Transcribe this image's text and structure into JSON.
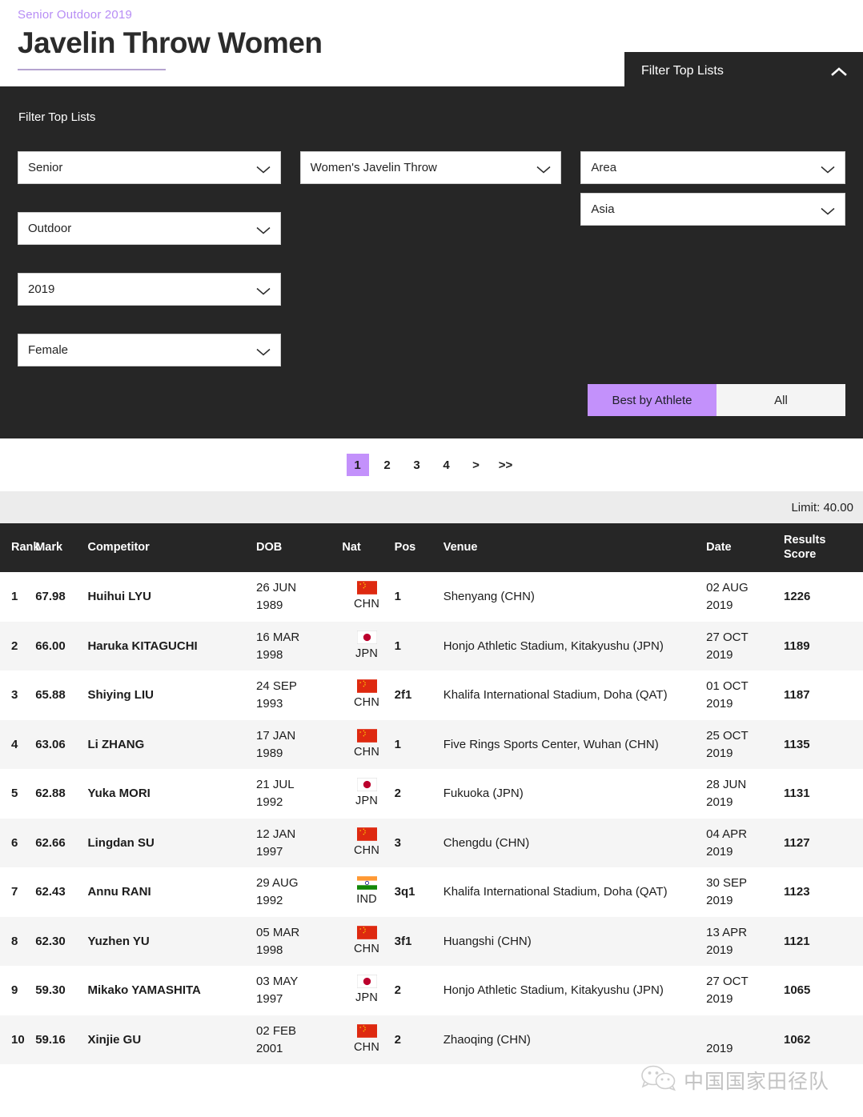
{
  "header": {
    "eyebrow": "Senior Outdoor 2019",
    "title": "Javelin Throw Women"
  },
  "filter_float": {
    "label": "Filter Top Lists",
    "chevron_icon": "chevron-up-icon"
  },
  "filter_panel": {
    "title": "Filter Top Lists",
    "selects": [
      {
        "name": "age-category",
        "value": "Senior"
      },
      {
        "name": "discipline",
        "value": "Women's Javelin Throw"
      },
      {
        "name": "area",
        "value": "Area"
      },
      {
        "name": "environment",
        "value": "Outdoor"
      },
      {
        "name": "region",
        "value": "Asia"
      },
      {
        "name": "season-year",
        "value": "2019"
      },
      {
        "name": "gender",
        "value": "Female"
      }
    ],
    "toggle": {
      "best_by_athlete": "Best by Athlete",
      "all": "All",
      "active": "Best by Athlete"
    }
  },
  "pagination": {
    "pages": [
      "1",
      "2",
      "3",
      "4"
    ],
    "next": ">",
    "last": ">>",
    "current": "1"
  },
  "limit_bar": {
    "text": "Limit: 40.00"
  },
  "table": {
    "columns": [
      "Rank",
      "Mark",
      "Competitor",
      "DOB",
      "Nat",
      "Pos",
      "Venue",
      "Date",
      "Results Score"
    ],
    "rows": [
      {
        "rank": "1",
        "mark": "67.98",
        "competitor": "Huihui LYU",
        "dob_day": "26 JUN",
        "dob_year": "1989",
        "nat": "CHN",
        "flag": "flag-china",
        "pos": "1",
        "venue": "Shenyang (CHN)",
        "date_day": "02 AUG",
        "date_year": "2019",
        "score": "1226"
      },
      {
        "rank": "2",
        "mark": "66.00",
        "competitor": "Haruka KITAGUCHI",
        "dob_day": "16 MAR",
        "dob_year": "1998",
        "nat": "JPN",
        "flag": "flag-japan",
        "pos": "1",
        "venue": "Honjo Athletic Stadium, Kitakyushu (JPN)",
        "date_day": "27 OCT",
        "date_year": "2019",
        "score": "1189"
      },
      {
        "rank": "3",
        "mark": "65.88",
        "competitor": "Shiying LIU",
        "dob_day": "24 SEP",
        "dob_year": "1993",
        "nat": "CHN",
        "flag": "flag-china",
        "pos": "2f1",
        "venue": "Khalifa International Stadium, Doha (QAT)",
        "date_day": "01 OCT",
        "date_year": "2019",
        "score": "1187"
      },
      {
        "rank": "4",
        "mark": "63.06",
        "competitor": "Li ZHANG",
        "dob_day": "17 JAN",
        "dob_year": "1989",
        "nat": "CHN",
        "flag": "flag-china",
        "pos": "1",
        "venue": "Five Rings Sports Center, Wuhan (CHN)",
        "date_day": "25 OCT",
        "date_year": "2019",
        "score": "1135"
      },
      {
        "rank": "5",
        "mark": "62.88",
        "competitor": "Yuka MORI",
        "dob_day": "21 JUL",
        "dob_year": "1992",
        "nat": "JPN",
        "flag": "flag-japan",
        "pos": "2",
        "venue": "Fukuoka (JPN)",
        "date_day": "28 JUN",
        "date_year": "2019",
        "score": "1131"
      },
      {
        "rank": "6",
        "mark": "62.66",
        "competitor": "Lingdan SU",
        "dob_day": "12 JAN",
        "dob_year": "1997",
        "nat": "CHN",
        "flag": "flag-china",
        "pos": "3",
        "venue": "Chengdu (CHN)",
        "date_day": "04 APR",
        "date_year": "2019",
        "score": "1127"
      },
      {
        "rank": "7",
        "mark": "62.43",
        "competitor": "Annu RANI",
        "dob_day": "29 AUG",
        "dob_year": "1992",
        "nat": "IND",
        "flag": "flag-india",
        "pos": "3q1",
        "venue": "Khalifa International Stadium, Doha (QAT)",
        "date_day": "30 SEP",
        "date_year": "2019",
        "score": "1123"
      },
      {
        "rank": "8",
        "mark": "62.30",
        "competitor": "Yuzhen YU",
        "dob_day": "05 MAR",
        "dob_year": "1998",
        "nat": "CHN",
        "flag": "flag-china",
        "pos": "3f1",
        "venue": "Huangshi (CHN)",
        "date_day": "13 APR",
        "date_year": "2019",
        "score": "1121"
      },
      {
        "rank": "9",
        "mark": "59.30",
        "competitor": "Mikako YAMASHITA",
        "dob_day": "03 MAY",
        "dob_year": "1997",
        "nat": "JPN",
        "flag": "flag-japan",
        "pos": "2",
        "venue": "Honjo Athletic Stadium, Kitakyushu (JPN)",
        "date_day": "",
        "date_year": "2019",
        "score": "1065",
        "date_day_visible": "27 OCT"
      },
      {
        "rank": "10",
        "mark": "59.16",
        "competitor": "Xinjie GU",
        "dob_day": "02 FEB",
        "dob_year": "2001",
        "nat": "CHN",
        "flag": "flag-china",
        "pos": "2",
        "venue": "Zhaoqing (CHN)",
        "date_day": "",
        "date_year": "2019",
        "score": "1062"
      }
    ]
  },
  "watermark": {
    "text": "中国国家田径队",
    "icon": "wechat-icon"
  },
  "colors": {
    "accent_purple": "#c391fb",
    "eyebrow_purple": "#b78df5",
    "panel_dark": "#262626",
    "row_alt": "#f5f5f5",
    "limit_bar": "#ececec"
  }
}
